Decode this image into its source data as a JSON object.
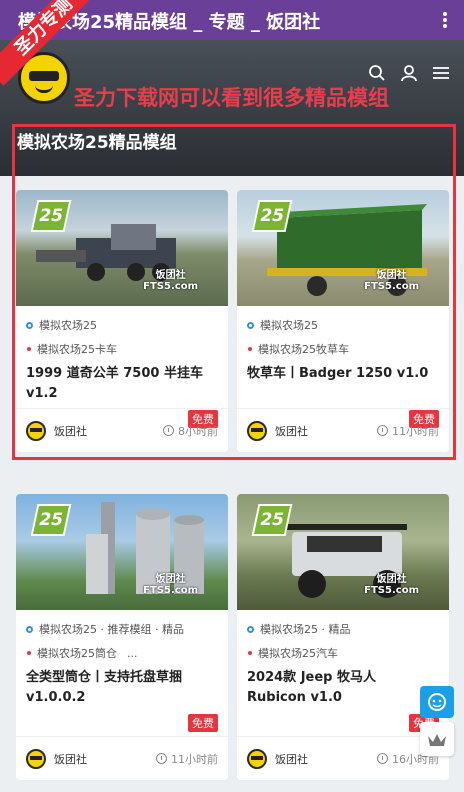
{
  "topbar": {
    "title": "模拟农场25精品模组 _ 专题 _ 饭团社"
  },
  "ribbon": {
    "text": "圣力专测"
  },
  "hero": {
    "promo": "圣力下载网可以看到很多精品模组",
    "heading": "模拟农场25精品模组"
  },
  "icons": {
    "search": "search-icon",
    "user": "user-icon",
    "menu": "menu-icon",
    "more": "more-vert-icon",
    "service": "customer-service-icon",
    "top": "back-to-top-icon"
  },
  "watermark": "饭团社\nFTS5.com",
  "cards": [
    {
      "category": "模拟农场25",
      "tag": "模拟农场25卡车",
      "tag_extra": "",
      "title": "1999 道奇公羊 7500 半挂车 v1.2",
      "price": "免费",
      "author": "饭团社",
      "time": "8小时前"
    },
    {
      "category": "模拟农场25",
      "tag": "模拟农场25牧草车",
      "tag_extra": "",
      "title": "牧草车丨Badger 1250 v1.0",
      "price": "免费",
      "author": "饭团社",
      "time": "11小时前"
    },
    {
      "category": "模拟农场25 · 推荐模组 · 精品",
      "tag": "模拟农场25筒仓",
      "tag_extra": "...",
      "title": "全类型筒仓丨支持托盘草捆 v1.0.0.2",
      "price": "免费",
      "author": "饭团社",
      "time": "11小时前"
    },
    {
      "category": "模拟农场25 · 精品",
      "tag": "模拟农场25汽车",
      "tag_extra": "",
      "title": "2024款 Jeep 牧马人 Rubicon v1.0",
      "price": "免费",
      "author": "饭团社",
      "time": "16小时前"
    }
  ]
}
